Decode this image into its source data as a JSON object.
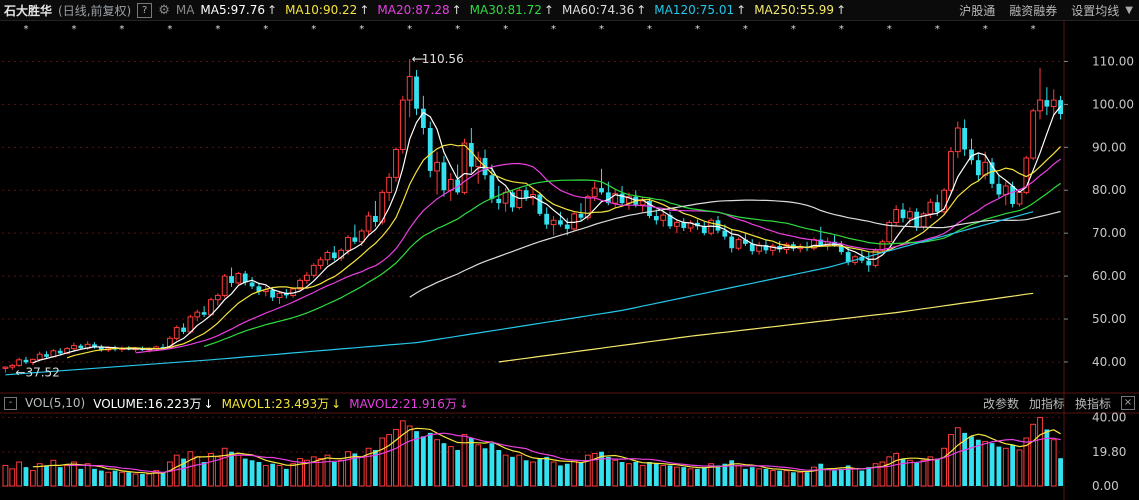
{
  "header": {
    "stock_name": "石大胜华",
    "period": "(日线,前复权)",
    "help": "?",
    "ma_label": "MA",
    "ma_items": [
      {
        "text": "MA5:97.76",
        "color": "#ffffff"
      },
      {
        "text": "MA10:90.22",
        "color": "#f5e43c"
      },
      {
        "text": "MA20:87.28",
        "color": "#e83fe0"
      },
      {
        "text": "MA30:81.72",
        "color": "#2fdc3e"
      },
      {
        "text": "MA60:74.36",
        "color": "#dcdcdc"
      },
      {
        "text": "MA120:75.01",
        "color": "#26c6e8"
      },
      {
        "text": "MA250:55.99",
        "color": "#f5e96b"
      }
    ],
    "up_arrow": "↑",
    "links": [
      "沪股通",
      "融资融券",
      "设置均线"
    ]
  },
  "volume_header": {
    "minus": "-",
    "title": "VOL(5,10)",
    "items": [
      {
        "text": "VOLUME:16.223万",
        "color": "#ffffff"
      },
      {
        "text": "MAVOL1:23.493万",
        "color": "#f5e43c"
      },
      {
        "text": "MAVOL2:21.916万",
        "color": "#e83fe0"
      }
    ],
    "down_arrow": "↓",
    "links": [
      "改参数",
      "加指标",
      "换指标"
    ],
    "close": "×"
  },
  "chart_data": {
    "type": "candlestick",
    "price_axis": {
      "ticks": [
        40,
        50,
        60,
        70,
        80,
        90,
        100,
        110
      ],
      "labels": [
        "40.00",
        "50.00",
        "60.00",
        "70.00",
        "80.00",
        "90.00",
        "100.00",
        "110.00"
      ]
    },
    "volume_axis": {
      "ticks": [
        0,
        19.8,
        40
      ],
      "labels": [
        "0.00",
        "19.80",
        "40.00"
      ],
      "unit": "万"
    },
    "annotations": {
      "high": {
        "value": 110.56,
        "label": "110.56"
      },
      "low": {
        "value": 37.52,
        "label": "37.52"
      }
    },
    "candles": [
      [
        38.5,
        39.0,
        37.52,
        38.8,
        12
      ],
      [
        38.8,
        39.5,
        38.2,
        39.2,
        10
      ],
      [
        39.2,
        41.0,
        38.9,
        40.5,
        14
      ],
      [
        40.5,
        41.2,
        39.5,
        39.9,
        11
      ],
      [
        39.9,
        40.8,
        39.3,
        40.6,
        9
      ],
      [
        40.6,
        42.4,
        40.2,
        41.8,
        13
      ],
      [
        41.8,
        42.5,
        40.8,
        41.2,
        12
      ],
      [
        41.2,
        43.0,
        41.0,
        42.6,
        15
      ],
      [
        42.6,
        43.2,
        41.5,
        42.0,
        11
      ],
      [
        42.0,
        43.5,
        41.8,
        43.1,
        12
      ],
      [
        43.1,
        44.5,
        42.6,
        43.8,
        14
      ],
      [
        43.8,
        44.2,
        42.9,
        43.2,
        10
      ],
      [
        43.2,
        44.8,
        42.8,
        44.1,
        13
      ],
      [
        44.1,
        44.6,
        43.1,
        43.5,
        10
      ],
      [
        43.5,
        44.0,
        42.4,
        42.8,
        9
      ],
      [
        42.8,
        43.7,
        42.3,
        43.3,
        8
      ],
      [
        43.3,
        43.8,
        42.5,
        42.9,
        9
      ],
      [
        42.9,
        43.6,
        42.3,
        43.2,
        8
      ],
      [
        43.2,
        43.7,
        42.7,
        42.9,
        8
      ],
      [
        42.9,
        43.5,
        42.3,
        43.1,
        7
      ],
      [
        43.1,
        43.6,
        42.6,
        42.8,
        7
      ],
      [
        42.8,
        43.4,
        42.2,
        43.0,
        7
      ],
      [
        43.0,
        43.8,
        42.7,
        43.5,
        9
      ],
      [
        43.5,
        44.2,
        42.9,
        43.4,
        8
      ],
      [
        43.4,
        46.0,
        43.1,
        45.5,
        14
      ],
      [
        45.5,
        48.5,
        45.0,
        48.0,
        18
      ],
      [
        48.0,
        49.0,
        46.5,
        47.0,
        16
      ],
      [
        47.0,
        51.0,
        46.6,
        50.5,
        20
      ],
      [
        50.5,
        52.2,
        49.5,
        51.6,
        17
      ],
      [
        51.6,
        53.0,
        50.5,
        51.0,
        14
      ],
      [
        51.0,
        55.0,
        50.8,
        54.5,
        19
      ],
      [
        54.5,
        56.0,
        53.2,
        55.5,
        17
      ],
      [
        55.5,
        60.5,
        55.0,
        60.0,
        22
      ],
      [
        60.0,
        62.0,
        57.5,
        58.4,
        20
      ],
      [
        58.4,
        61.0,
        58.0,
        60.6,
        18
      ],
      [
        60.6,
        61.2,
        57.8,
        58.5,
        16
      ],
      [
        58.5,
        59.8,
        57.0,
        57.6,
        15
      ],
      [
        57.6,
        58.4,
        55.6,
        56.4,
        14
      ],
      [
        56.4,
        57.8,
        55.3,
        56.8,
        12
      ],
      [
        56.8,
        57.5,
        54.2,
        55.0,
        13
      ],
      [
        55.0,
        56.5,
        53.5,
        56.0,
        12
      ],
      [
        56.0,
        57.0,
        54.8,
        55.5,
        10
      ],
      [
        55.5,
        57.5,
        55.0,
        57.0,
        13
      ],
      [
        57.0,
        59.5,
        56.4,
        59.0,
        16
      ],
      [
        59.0,
        61.0,
        58.2,
        60.2,
        15
      ],
      [
        60.2,
        63.0,
        59.6,
        62.5,
        17
      ],
      [
        62.5,
        64.5,
        61.6,
        63.8,
        16
      ],
      [
        63.8,
        66.0,
        62.6,
        65.5,
        18
      ],
      [
        65.5,
        67.0,
        63.6,
        64.2,
        14
      ],
      [
        64.2,
        66.5,
        63.5,
        66.0,
        15
      ],
      [
        66.0,
        69.5,
        65.0,
        69.0,
        20
      ],
      [
        69.0,
        72.0,
        67.5,
        68.0,
        19
      ],
      [
        68.0,
        71.0,
        67.0,
        70.5,
        17
      ],
      [
        70.5,
        75.0,
        69.6,
        74.0,
        22
      ],
      [
        74.0,
        77.5,
        71.5,
        72.6,
        21
      ],
      [
        72.6,
        80.0,
        72.0,
        79.5,
        28
      ],
      [
        79.5,
        84.0,
        77.5,
        83.0,
        30
      ],
      [
        83.0,
        90.0,
        82.0,
        89.5,
        33
      ],
      [
        89.5,
        102.0,
        88.5,
        101.0,
        38
      ],
      [
        101.0,
        110.56,
        97.0,
        106.5,
        35
      ],
      [
        106.5,
        108.0,
        97.5,
        99.0,
        32
      ],
      [
        99.0,
        102.0,
        93.0,
        94.5,
        29
      ],
      [
        94.5,
        96.0,
        83.0,
        84.5,
        31
      ],
      [
        84.5,
        89.0,
        79.0,
        86.5,
        27
      ],
      [
        86.5,
        88.0,
        78.5,
        80.0,
        25
      ],
      [
        80.0,
        84.0,
        77.5,
        82.5,
        23
      ],
      [
        82.5,
        86.0,
        79.0,
        79.5,
        21
      ],
      [
        79.5,
        92.0,
        79.0,
        91.0,
        30
      ],
      [
        91.0,
        94.5,
        84.0,
        85.5,
        28
      ],
      [
        85.5,
        89.0,
        81.5,
        87.5,
        24
      ],
      [
        87.5,
        89.5,
        82.5,
        83.5,
        22
      ],
      [
        83.5,
        86.0,
        77.0,
        78.0,
        25
      ],
      [
        78.0,
        81.0,
        75.5,
        77.0,
        21
      ],
      [
        77.0,
        80.5,
        75.0,
        79.5,
        18
      ],
      [
        79.5,
        80.0,
        75.0,
        76.0,
        17
      ],
      [
        76.0,
        80.5,
        75.5,
        80.0,
        18
      ],
      [
        80.0,
        80.8,
        77.5,
        78.2,
        15
      ],
      [
        78.2,
        80.5,
        76.5,
        79.0,
        14
      ],
      [
        79.0,
        79.5,
        74.0,
        74.5,
        16
      ],
      [
        74.5,
        76.0,
        71.0,
        72.0,
        17
      ],
      [
        72.0,
        74.0,
        69.5,
        73.0,
        14
      ],
      [
        73.0,
        75.0,
        71.5,
        72.0,
        12
      ],
      [
        72.0,
        73.5,
        69.5,
        71.0,
        13
      ],
      [
        71.0,
        75.0,
        70.5,
        74.5,
        15
      ],
      [
        74.5,
        77.0,
        73.0,
        73.6,
        14
      ],
      [
        73.6,
        79.0,
        73.0,
        78.5,
        18
      ],
      [
        78.5,
        82.0,
        77.5,
        80.5,
        19
      ],
      [
        80.5,
        85.0,
        79.0,
        79.5,
        20
      ],
      [
        79.5,
        82.0,
        76.5,
        77.0,
        17
      ],
      [
        77.0,
        80.0,
        76.0,
        79.2,
        15
      ],
      [
        79.2,
        81.0,
        76.5,
        77.0,
        14
      ],
      [
        77.0,
        79.5,
        75.5,
        78.5,
        13
      ],
      [
        78.5,
        80.0,
        76.0,
        76.6,
        14
      ],
      [
        76.6,
        78.5,
        75.0,
        77.5,
        12
      ],
      [
        77.5,
        78.2,
        73.5,
        74.0,
        14
      ],
      [
        74.0,
        75.5,
        72.0,
        73.0,
        13
      ],
      [
        73.0,
        75.0,
        71.5,
        74.2,
        12
      ],
      [
        74.2,
        75.0,
        71.0,
        71.6,
        12
      ],
      [
        71.6,
        73.0,
        70.0,
        72.5,
        11
      ],
      [
        72.5,
        73.5,
        70.5,
        71.2,
        11
      ],
      [
        71.2,
        73.0,
        70.2,
        72.4,
        10
      ],
      [
        72.4,
        73.2,
        70.8,
        71.6,
        10
      ],
      [
        71.6,
        72.6,
        69.5,
        70.0,
        11
      ],
      [
        70.0,
        73.5,
        69.5,
        73.0,
        13
      ],
      [
        73.0,
        74.0,
        70.0,
        70.6,
        12
      ],
      [
        70.6,
        72.0,
        68.5,
        69.2,
        13
      ],
      [
        69.2,
        71.0,
        65.5,
        66.5,
        15
      ],
      [
        66.5,
        69.0,
        66.0,
        68.5,
        12
      ],
      [
        68.5,
        70.0,
        67.0,
        67.5,
        10
      ],
      [
        67.5,
        68.6,
        65.0,
        65.8,
        11
      ],
      [
        65.8,
        68.0,
        65.0,
        67.2,
        10
      ],
      [
        67.2,
        68.5,
        65.2,
        66.0,
        10
      ],
      [
        66.0,
        67.6,
        64.8,
        67.0,
        9
      ],
      [
        67.0,
        68.2,
        65.5,
        66.2,
        9
      ],
      [
        66.2,
        67.8,
        65.2,
        67.4,
        9
      ],
      [
        67.4,
        68.0,
        65.8,
        66.4,
        8
      ],
      [
        66.4,
        67.5,
        65.5,
        66.9,
        8
      ],
      [
        66.9,
        68.0,
        65.8,
        66.5,
        8
      ],
      [
        66.5,
        69.0,
        66.0,
        68.5,
        11
      ],
      [
        68.5,
        71.5,
        67.8,
        67.2,
        13
      ],
      [
        67.2,
        69.0,
        66.0,
        68.0,
        10
      ],
      [
        68.0,
        69.5,
        66.8,
        67.0,
        9
      ],
      [
        67.0,
        68.2,
        65.0,
        65.6,
        10
      ],
      [
        65.6,
        66.8,
        62.5,
        63.2,
        12
      ],
      [
        63.2,
        65.0,
        62.6,
        64.5,
        10
      ],
      [
        64.5,
        66.0,
        63.0,
        63.6,
        9
      ],
      [
        63.6,
        65.5,
        61.0,
        62.5,
        11
      ],
      [
        62.5,
        66.5,
        62.0,
        66.0,
        13
      ],
      [
        66.0,
        68.5,
        65.5,
        68.0,
        14
      ],
      [
        68.0,
        73.0,
        67.5,
        72.5,
        17
      ],
      [
        72.5,
        76.5,
        71.5,
        75.5,
        19
      ],
      [
        75.5,
        77.0,
        72.5,
        73.5,
        16
      ],
      [
        73.5,
        76.0,
        72.0,
        75.0,
        15
      ],
      [
        75.0,
        75.8,
        70.5,
        71.5,
        14
      ],
      [
        71.5,
        75.0,
        70.8,
        74.5,
        15
      ],
      [
        74.5,
        78.0,
        73.5,
        77.2,
        17
      ],
      [
        77.2,
        79.0,
        74.0,
        75.0,
        16
      ],
      [
        75.0,
        80.5,
        74.5,
        80.0,
        22
      ],
      [
        80.0,
        90.0,
        79.5,
        89.0,
        30
      ],
      [
        89.0,
        96.0,
        87.5,
        94.5,
        34
      ],
      [
        94.5,
        96.5,
        88.0,
        89.5,
        31
      ],
      [
        89.5,
        92.0,
        86.0,
        87.0,
        29
      ],
      [
        87.0,
        88.5,
        82.0,
        83.5,
        27
      ],
      [
        83.5,
        89.0,
        82.5,
        86.5,
        26
      ],
      [
        86.5,
        87.5,
        80.5,
        81.5,
        25
      ],
      [
        81.5,
        83.5,
        78.0,
        79.0,
        23
      ],
      [
        79.0,
        82.0,
        76.5,
        81.0,
        22
      ],
      [
        81.0,
        82.0,
        76.0,
        76.8,
        24
      ],
      [
        76.8,
        80.0,
        76.2,
        79.5,
        21
      ],
      [
        79.5,
        88.0,
        79.0,
        87.5,
        28
      ],
      [
        87.5,
        99.0,
        87.0,
        98.5,
        36
      ],
      [
        98.5,
        108.5,
        96.5,
        101.0,
        40
      ],
      [
        101.0,
        104.0,
        97.5,
        99.5,
        33
      ],
      [
        99.5,
        103.5,
        97.5,
        101.0,
        27
      ],
      [
        101.0,
        102.0,
        96.5,
        97.76,
        16.223
      ]
    ],
    "ma_series": [
      {
        "name": "MA5",
        "color": "#ffffff"
      },
      {
        "name": "MA10",
        "color": "#f5e43c"
      },
      {
        "name": "MA20",
        "color": "#e83fe0"
      },
      {
        "name": "MA30",
        "color": "#2fdc3e"
      },
      {
        "name": "MA60",
        "color": "#dcdcdc"
      },
      {
        "name": "MA120",
        "color": "#26c6e8"
      },
      {
        "name": "MA250",
        "color": "#f5e96b"
      }
    ],
    "volume_ma_series": [
      {
        "name": "MAVOL1",
        "period": 5,
        "color": "#f5e43c"
      },
      {
        "name": "MAVOL2",
        "period": 10,
        "color": "#e83fe0"
      }
    ],
    "ma120_points": [
      [
        0,
        37.0
      ],
      [
        30,
        40.5
      ],
      [
        60,
        44.5
      ],
      [
        90,
        52.0
      ],
      [
        120,
        62.0
      ],
      [
        150,
        75.0
      ]
    ],
    "ma250_points": [
      [
        72,
        40.0
      ],
      [
        100,
        46.0
      ],
      [
        130,
        51.5
      ],
      [
        150,
        56.0
      ]
    ],
    "colors": {
      "up": "#ff3b3b",
      "down": "#33e1ef",
      "grid": "#5a1414",
      "axis_text": "#c8c8c8"
    }
  }
}
